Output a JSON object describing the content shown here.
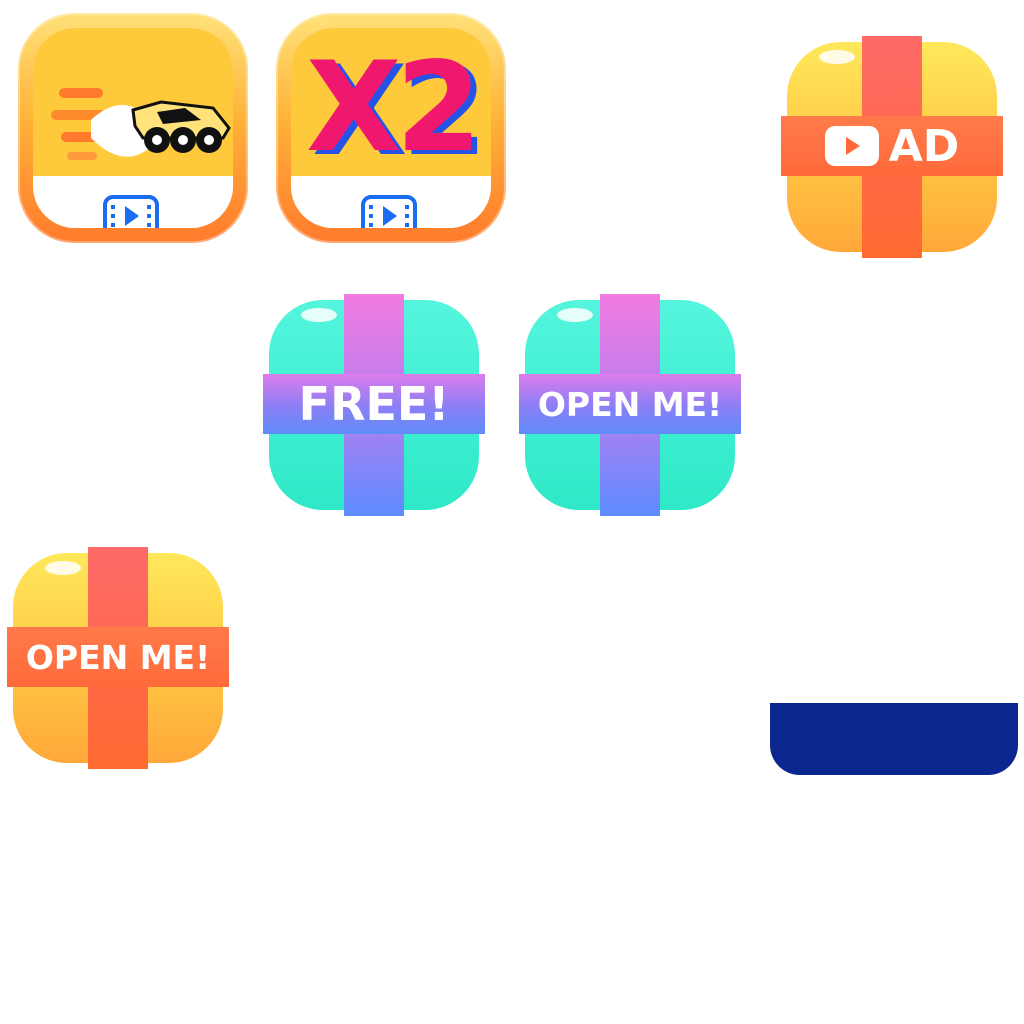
{
  "colors": {
    "tile_frame": "#ff8a2c",
    "tile_fill": "#ffc93c",
    "x2_text": "#f0186e",
    "x2_shadow": "#2453e8",
    "video_icon": "#1a6cf0",
    "gold_ribbon": "#ff6a3a",
    "mint_box": "#3df0d2",
    "mint_ribbon": "#8a7ff6",
    "navy_button": "#0b278f"
  },
  "boosters": {
    "speed": {
      "icon": "speed-car-icon",
      "action_icon": "video-play-icon"
    },
    "double": {
      "label": "X2",
      "action_icon": "video-play-icon"
    }
  },
  "gifts": {
    "ad_gift": {
      "label": "AD",
      "icon": "play-icon"
    },
    "free_gift": {
      "label": "FREE!"
    },
    "open_gift_mint": {
      "label": "OPEN ME!"
    },
    "open_gift_gold": {
      "label": "OPEN ME!"
    }
  }
}
